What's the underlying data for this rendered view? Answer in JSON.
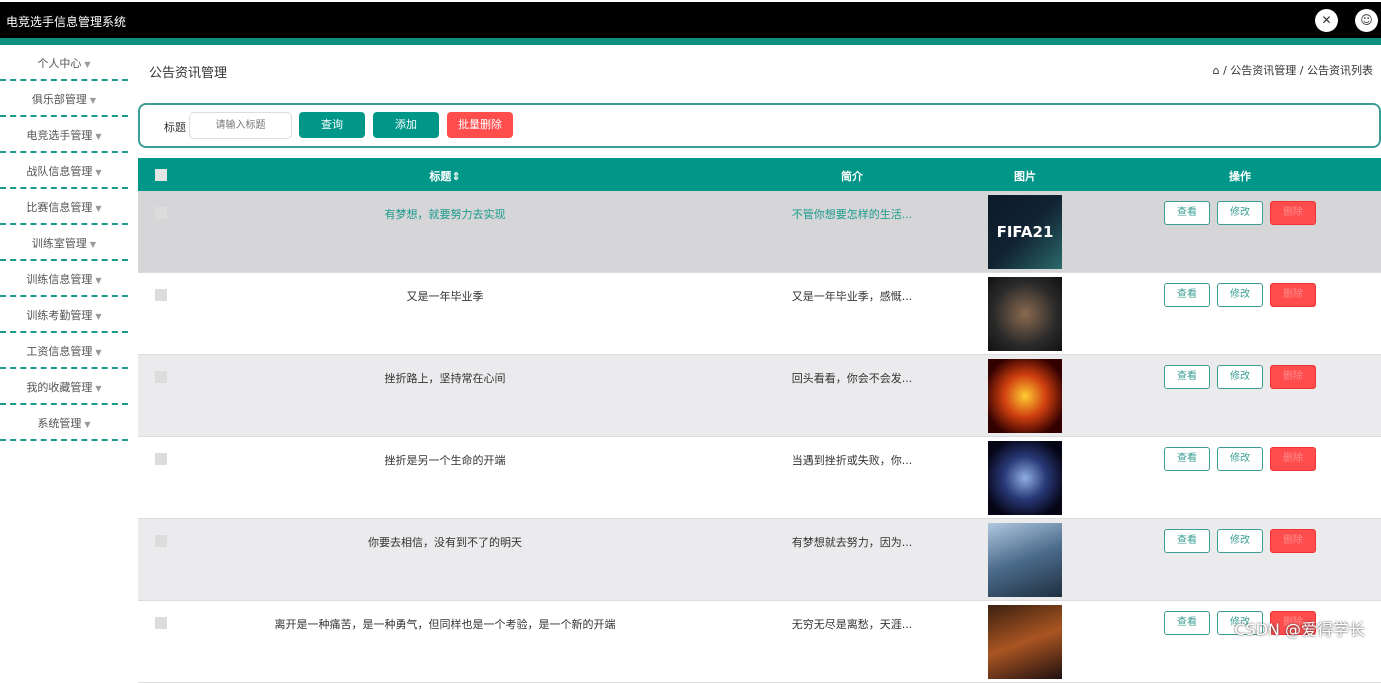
{
  "app": {
    "title": "电竞选手信息管理系统",
    "icons": [
      "fullscreen-icon",
      "user-icon"
    ]
  },
  "sidebar": {
    "items": [
      "个人中心",
      "俱乐部管理",
      "电竞选手管理",
      "战队信息管理",
      "比赛信息管理",
      "训练室管理",
      "训练信息管理",
      "训练考勤管理",
      "工资信息管理",
      "我的收藏管理",
      "系统管理"
    ]
  },
  "page": {
    "title": "公告资讯管理",
    "breadcrumb": [
      "公告资讯管理",
      "公告资讯列表"
    ]
  },
  "search": {
    "label": "标题",
    "placeholder": "请输入标题",
    "query": "查询",
    "add": "添加",
    "batch_delete": "批量删除"
  },
  "table": {
    "headers": {
      "title": "标题⇕",
      "intro": "简介",
      "image": "图片",
      "ops": "操作"
    },
    "rows": [
      {
        "title": "有梦想，就要努力去实现",
        "intro": "不管你想要怎样的生活...",
        "img": "FIFA21"
      },
      {
        "title": "又是一年毕业季",
        "intro": "又是一年毕业季，感慨...",
        "img": ""
      },
      {
        "title": "挫折路上，坚持常在心间",
        "intro": "回头看看，你会不会发...",
        "img": ""
      },
      {
        "title": "挫折是另一个生命的开端",
        "intro": "当遇到挫折或失败，你...",
        "img": ""
      },
      {
        "title": "你要去相信，没有到不了的明天",
        "intro": "有梦想就去努力，因为...",
        "img": ""
      },
      {
        "title": "离开是一种痛苦，是一种勇气，但同样也是一个考验，是一个新的开端",
        "intro": "无穷无尽是离愁，天涯...",
        "img": ""
      }
    ],
    "actions": {
      "view": "查看",
      "edit": "修改",
      "delete": "删除"
    }
  },
  "colors": {
    "accent": "#009688",
    "danger": "#ff4d4d",
    "topbar": "#000000"
  },
  "watermark": "CSDN @爱得学长"
}
